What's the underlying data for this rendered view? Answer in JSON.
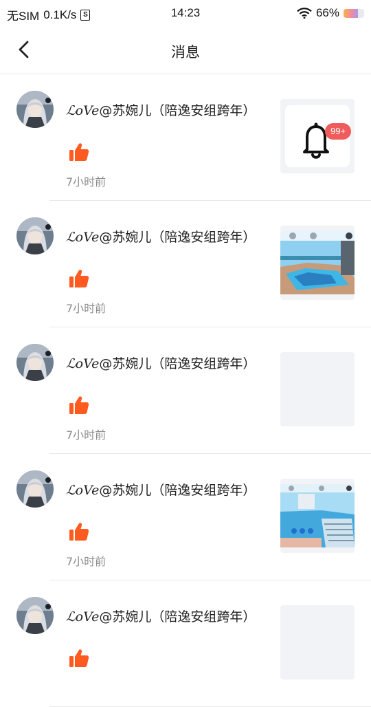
{
  "status_bar": {
    "carrier": "无SIM",
    "speed": "0.1K/s",
    "sim_badge": "S",
    "time": "14:23",
    "battery": "66%"
  },
  "nav": {
    "title": "消息"
  },
  "messages": [
    {
      "user_script": "ℒ𝑜Ve",
      "user_rest": "@苏婉儿（陪逸安组跨年）",
      "time": "7小时前",
      "thumb": "bell",
      "badge": "99+"
    },
    {
      "user_script": "ℒ𝑜Ve",
      "user_rest": "@苏婉儿（陪逸安组跨年）",
      "time": "7小时前",
      "thumb": "pool-scene"
    },
    {
      "user_script": "ℒ𝑜Ve",
      "user_rest": "@苏婉儿（陪逸安组跨年）",
      "time": "7小时前",
      "thumb": "empty"
    },
    {
      "user_script": "ℒ𝑜Ve",
      "user_rest": "@苏婉儿（陪逸安组跨年）",
      "time": "7小时前",
      "thumb": "pool-stairs-scene"
    },
    {
      "user_script": "ℒ𝑜Ve",
      "user_rest": "@苏婉儿（陪逸安组跨年）",
      "time": "",
      "thumb": "empty"
    }
  ],
  "colors": {
    "like": "#ff5a1f",
    "badge": "#f05b5b",
    "time_text": "#8c8c8c"
  }
}
